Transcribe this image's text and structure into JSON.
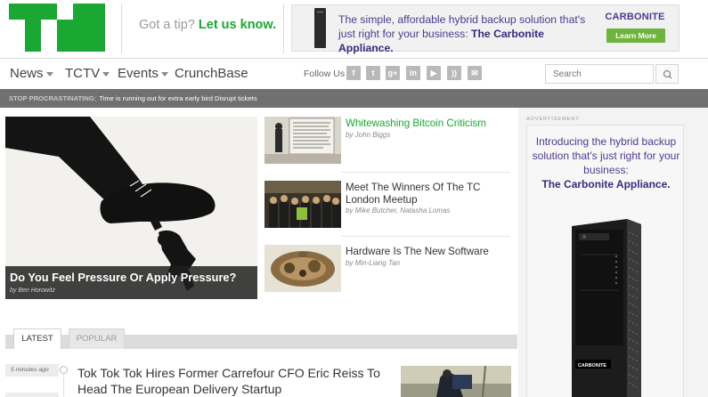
{
  "header": {
    "logo": "TC",
    "tip_prefix": "Got a tip?",
    "tip_link": "Let us know."
  },
  "top_ad": {
    "copy_line": "The simple, affordable hybrid backup solution that's just right for your business:",
    "copy_bold": "The Carbonite Appliance.",
    "brand": "CARBONITE",
    "cta": "Learn More"
  },
  "nav": {
    "items": [
      {
        "label": "News"
      },
      {
        "label": "TCTV"
      },
      {
        "label": "Events"
      },
      {
        "label": "CrunchBase"
      }
    ],
    "follow_label": "Follow Us",
    "social": [
      {
        "icon": "facebook-icon",
        "glyph": "f"
      },
      {
        "icon": "twitter-icon",
        "glyph": "t"
      },
      {
        "icon": "google-plus-icon",
        "glyph": "g+"
      },
      {
        "icon": "linkedin-icon",
        "glyph": "in"
      },
      {
        "icon": "youtube-icon",
        "glyph": "▶"
      },
      {
        "icon": "rss-icon",
        "glyph": "))"
      },
      {
        "icon": "email-icon",
        "glyph": "✉"
      }
    ],
    "search_placeholder": "Search"
  },
  "ticker": {
    "label": "Stop Procrastinating:",
    "text": "Time is running out for extra early bird Disrupt tickets"
  },
  "hero": {
    "title": "Do You Feel Pressure Or Apply Pressure?",
    "byline": "by Ben Horowitz"
  },
  "stories": [
    {
      "title": "Whitewashing Bitcoin Criticism",
      "byline": "by John Biggs"
    },
    {
      "title": "Meet The Winners Of The TC London Meetup",
      "byline": "by Mike Butcher, Natasha Lomas"
    },
    {
      "title": "Hardware Is The New Software",
      "byline": "by Min-Liang Tan"
    }
  ],
  "tabs": {
    "latest": "LATEST",
    "popular": "POPULAR"
  },
  "river": {
    "time": "5 minutes ago",
    "title": "Tok Tok Tok Hires Former Carrefour CFO Eric Reiss To Head The European Delivery Startup"
  },
  "side_ad": {
    "label": "ADVERTISEMENT",
    "copy": "Introducing the hybrid backup solution that's just right for your business:",
    "copy_bold": "The Carbonite Appliance.",
    "device_label": "CARBONITE"
  },
  "colors": {
    "brand_green": "#1aa832",
    "ad_purple": "#4f3a8e",
    "ticker_bg": "#6e716e"
  }
}
